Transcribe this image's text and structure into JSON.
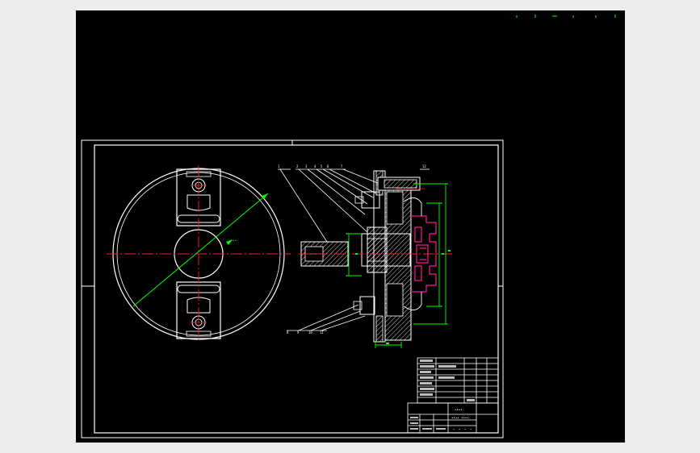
{
  "colors": {
    "background": "#000000",
    "frame": "#ffffff",
    "centerline": "#ff2020",
    "dimension": "#00ff00",
    "highlight": "#ff1493",
    "hatch": "#ffffff",
    "workspace": "#ececec"
  },
  "icons": {
    "top_markers": [
      "tick-mark-icon",
      "tick-mark-icon",
      "tick-mark-icon",
      "tick-mark-icon",
      "tick-mark-icon",
      "tick-mark-icon"
    ]
  },
  "title_block": {
    "name_cell": "••••",
    "part_no": "•••• ••••",
    "scale_cells": [
      "•",
      "•",
      "•",
      "•"
    ]
  },
  "callouts": {
    "top": [
      "1",
      "2",
      "3",
      "4",
      "5",
      "6",
      "7"
    ],
    "bottom": [
      "8",
      "9",
      "10",
      "11"
    ],
    "right_top": "12"
  }
}
